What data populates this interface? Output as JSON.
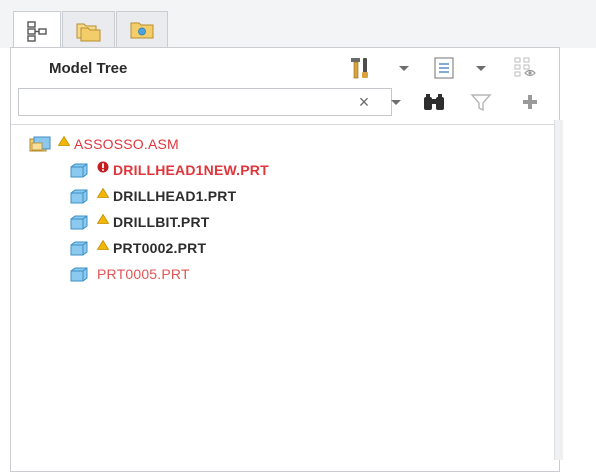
{
  "tabs": [
    {
      "icon": "model-tree-tab-icon",
      "active": true
    },
    {
      "icon": "folder-browser-tab-icon",
      "active": false
    },
    {
      "icon": "favorites-tab-icon",
      "active": false
    }
  ],
  "header": {
    "title": "Model Tree"
  },
  "toolbar": {
    "settings_icon": "tools-icon",
    "show_icon": "list-icon",
    "filter_tree_icon": "tree-filter-icon"
  },
  "search": {
    "value": "",
    "placeholder": ""
  },
  "search_tools": {
    "clear": "×",
    "find_icon": "binoculars-icon",
    "filter_icon": "funnel-icon",
    "add_icon": "plus-icon"
  },
  "tree": {
    "root": {
      "label": "ASSOSSO.ASM",
      "status": "warning"
    },
    "children": [
      {
        "label": "DRILLHEAD1NEW.PRT",
        "status": "error"
      },
      {
        "label": "DRILLHEAD1.PRT",
        "status": "warning"
      },
      {
        "label": "DRILLBIT.PRT",
        "status": "warning"
      },
      {
        "label": "PRT0002.PRT",
        "status": "warning"
      },
      {
        "label": "PRT0005.PRT",
        "status": "missing"
      }
    ]
  },
  "colors": {
    "error": "#e0353b",
    "warning": "#f2b705",
    "part_blue": "#5fb7e3"
  }
}
